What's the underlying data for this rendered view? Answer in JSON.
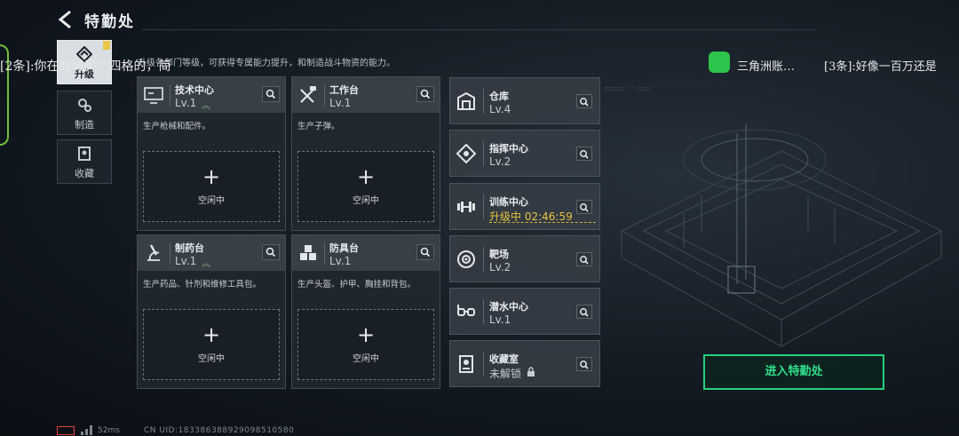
{
  "header": {
    "title": "特勤处"
  },
  "subtitle": "升级各部门等级，可获得专属能力提升，和制造战斗物资的能力。",
  "overlay": {
    "danmaku_left": "[2条]:你在商城买个四格的，简",
    "wechat_text": "三角洲账…",
    "danmaku_right": "[3条]:好像一百万还是"
  },
  "nav": [
    {
      "label": "升级",
      "icon": "upgrade-icon",
      "active": true
    },
    {
      "label": "制造",
      "icon": "gears-icon",
      "active": false
    },
    {
      "label": "收藏",
      "icon": "collection-icon",
      "active": false
    }
  ],
  "cards": [
    {
      "name": "技术中心",
      "level": "Lv.1",
      "desc": "生产枪械和配件。",
      "slot": "空闲中",
      "icon": "monitor-icon"
    },
    {
      "name": "工作台",
      "level": "Lv.1",
      "desc": "生产子弹。",
      "slot": "空闲中",
      "icon": "tools-icon"
    },
    {
      "name": "制药台",
      "level": "Lv.1",
      "desc": "生产药品、针剂和维修工具包。",
      "slot": "空闲中",
      "icon": "microscope-icon"
    },
    {
      "name": "防具台",
      "level": "Lv.1",
      "desc": "生产头盔、护甲、胸挂和背包。",
      "slot": "空闲中",
      "icon": "armor-icon"
    }
  ],
  "facilities": [
    {
      "name": "仓库",
      "status": "Lv.4",
      "icon": "warehouse-icon"
    },
    {
      "name": "指挥中心",
      "status": "Lv.2",
      "icon": "command-icon"
    },
    {
      "name": "训练中心",
      "status": "升级中 02:46:59",
      "icon": "dumbbell-icon"
    },
    {
      "name": "靶场",
      "status": "Lv.2",
      "icon": "target-icon"
    },
    {
      "name": "潜水中心",
      "status": "Lv.1",
      "icon": "diving-icon"
    },
    {
      "name": "收藏室",
      "status": "未解锁",
      "icon": "trophy-icon"
    }
  ],
  "enter_button": "进入特勤处",
  "footer": {
    "ping": "52ms",
    "uid": "CN UID:183386388929098510580"
  },
  "colors": {
    "accent_green": "#2fe08a",
    "upgrade_yellow": "#e8c340",
    "battery_red": "#e24141"
  }
}
